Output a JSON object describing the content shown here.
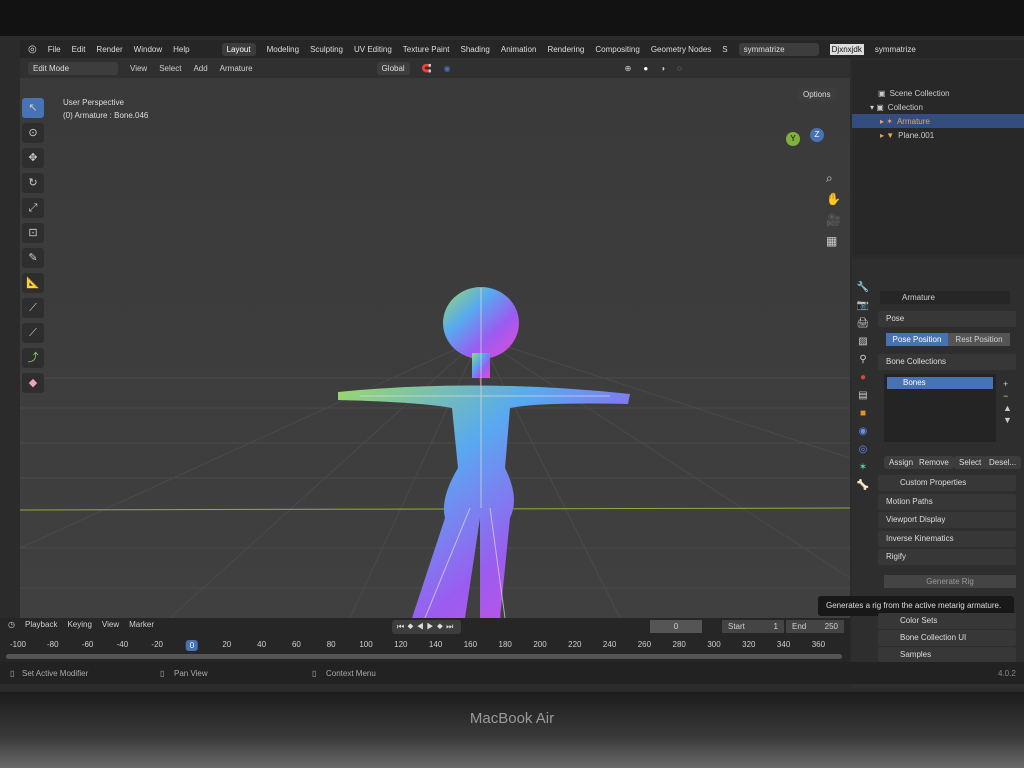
{
  "device": {
    "brand": "MacBook Air"
  },
  "menubar": {
    "items": [
      "File",
      "Edit",
      "Render",
      "Window",
      "Help"
    ],
    "workspaces": [
      "Layout",
      "Modeling",
      "Sculpting",
      "UV Editing",
      "Texture Paint",
      "Shading",
      "Animation",
      "Rendering",
      "Compositing",
      "Geometry Nodes",
      "S"
    ],
    "active_workspace": "Layout",
    "scene": "symmatrize",
    "view_layer": "Djxnxjdk",
    "view_layer_name": "symmatrize"
  },
  "viewport_header": {
    "mode": "Edit Mode",
    "menus": [
      "View",
      "Select",
      "Add",
      "Armature"
    ],
    "transform": "Global",
    "options": "Options"
  },
  "viewport": {
    "perspective": "User Perspective",
    "active": "(0) Armature : Bone.046",
    "gizmo": {
      "y": "Y",
      "z": "Z"
    }
  },
  "outliner": {
    "rows": [
      "Scene Collection",
      "Collection",
      "Armature",
      "Plane.001"
    ]
  },
  "properties": {
    "object": "Armature",
    "pose": {
      "title": "Pose",
      "pose_position": "Pose Position",
      "rest_position": "Rest Position"
    },
    "bone_collections": {
      "title": "Bone Collections",
      "items": [
        "Bones"
      ],
      "assign": "Assign",
      "remove": "Remove",
      "select": "Select",
      "deselect": "Desel..."
    },
    "panels": [
      "Custom Properties",
      "Motion Paths",
      "Viewport Display",
      "Inverse Kinematics"
    ],
    "rigify": {
      "title": "Rigify",
      "generate": "Generate Rig",
      "tooltip": "Generates a rig from the active metarig armature."
    },
    "subpanels": [
      "Color Sets",
      "Bone Collection UI",
      "Samples"
    ]
  },
  "timeline": {
    "menus": [
      "Playback",
      "Keying",
      "View",
      "Marker"
    ],
    "current_frame": "0",
    "start_label": "Start",
    "start": "1",
    "end_label": "End",
    "end": "250",
    "ticks": [
      "-100",
      "-80",
      "-60",
      "-40",
      "-20",
      "0",
      "20",
      "40",
      "60",
      "80",
      "100",
      "120",
      "140",
      "160",
      "180",
      "200",
      "220",
      "240",
      "260",
      "280",
      "300",
      "320",
      "340",
      "360"
    ]
  },
  "status": {
    "left": "Set Active Modifier",
    "middle": "Pan View",
    "right": "Context Menu",
    "version": "4.0.2"
  },
  "colors": {
    "accent": "#4772b3",
    "selected_text": "#e8a25c",
    "tooltip_bg": "#181818"
  }
}
